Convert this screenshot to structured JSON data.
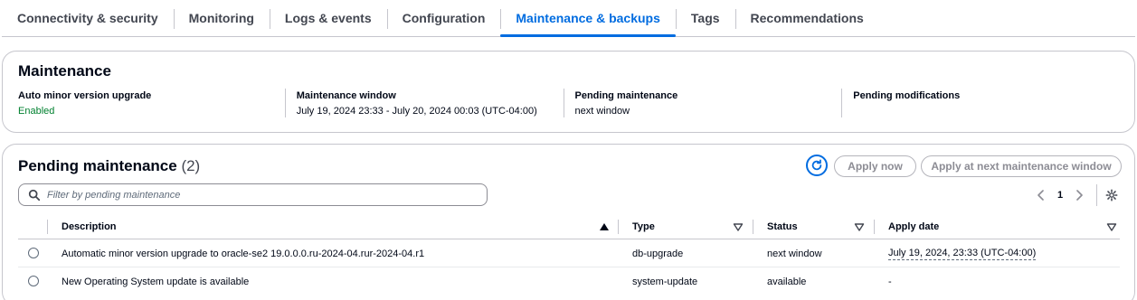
{
  "tabs": [
    {
      "label": "Connectivity & security"
    },
    {
      "label": "Monitoring"
    },
    {
      "label": "Logs & events"
    },
    {
      "label": "Configuration"
    },
    {
      "label": "Maintenance & backups",
      "active": true
    },
    {
      "label": "Tags"
    },
    {
      "label": "Recommendations"
    }
  ],
  "maintenance": {
    "title": "Maintenance",
    "fields": [
      {
        "label": "Auto minor version upgrade",
        "value": "Enabled"
      },
      {
        "label": "Maintenance window",
        "value": "July 19, 2024 23:33 - July 20, 2024 00:03 (UTC-04:00)"
      },
      {
        "label": "Pending maintenance",
        "value": "next window"
      },
      {
        "label": "Pending modifications",
        "value": ""
      }
    ]
  },
  "pending": {
    "title": "Pending maintenance",
    "count": "(2)",
    "refresh_icon": "refresh-icon",
    "apply_now_label": "Apply now",
    "apply_next_label": "Apply at next maintenance window",
    "search_placeholder": "Filter by pending maintenance",
    "page": "1",
    "columns": {
      "description": "Description",
      "type": "Type",
      "status": "Status",
      "apply_date": "Apply date"
    },
    "rows": [
      {
        "description": "Automatic minor version upgrade to oracle-se2 19.0.0.0.ru-2024-04.rur-2024-04.r1",
        "type": "db-upgrade",
        "status": "next window",
        "apply_date": "July 19, 2024, 23:33 (UTC-04:00)"
      },
      {
        "description": "New Operating System update is available",
        "type": "system-update",
        "status": "available",
        "apply_date": "-"
      }
    ]
  },
  "colors": {
    "accent": "#006ce0",
    "success": "#00802f",
    "border": "#c6c6cd",
    "disabled_text": "#8c8c94"
  }
}
